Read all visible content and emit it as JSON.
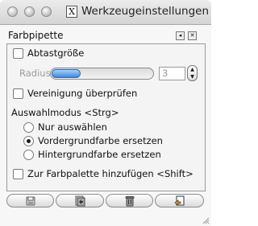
{
  "window": {
    "title": "Werkzeugeinstellungen",
    "x11_glyph": "X"
  },
  "panel": {
    "title": "Farbpipette",
    "menu_button": "◂",
    "close_button": "✕"
  },
  "sample": {
    "label": "Abtastgröße",
    "checked": false
  },
  "radius": {
    "label": "Radius:",
    "value": "3",
    "slider_fraction": 0.0
  },
  "merge": {
    "label": "Vereinigung überprüfen",
    "checked": false
  },
  "mode": {
    "label": "Auswahlmodus  <Strg>",
    "options": [
      {
        "label": "Nur auswählen",
        "selected": false
      },
      {
        "label": "Vordergrundfarbe ersetzen",
        "selected": true
      },
      {
        "label": "Hintergrundfarbe ersetzen",
        "selected": false
      }
    ]
  },
  "palette": {
    "label": "Zur Farbpalette hinzufügen <Shift>",
    "checked": false
  },
  "buttons": {
    "save": "save-icon",
    "restore": "restore-icon",
    "delete": "trash-icon",
    "reset": "reset-icon"
  }
}
